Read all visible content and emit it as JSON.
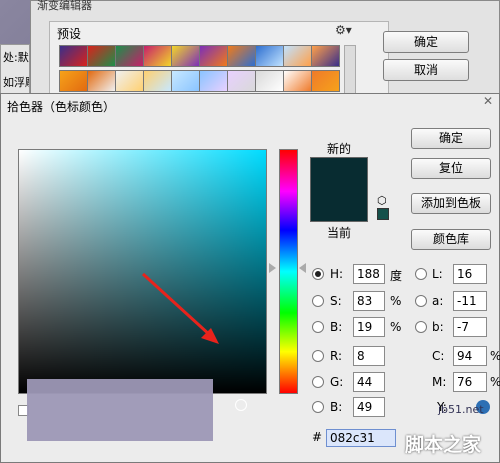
{
  "bg_dialog": {
    "title": "渐变编辑器",
    "presets_label": "预设",
    "gear_glyph": "⚙▾",
    "ok": "确定",
    "cancel": "取消",
    "left_lines": [
      "处:默认",
      "如浮雕"
    ]
  },
  "preset_swatches": [
    [
      "#3a2f8a",
      "#d9221c",
      "#1c8f4a",
      "#c71f6a",
      "#f2d62a",
      "#7c2fb8",
      "#f07a1a",
      "#2e6fd0",
      "#c0e2ff",
      "#ffa04a"
    ],
    [
      "#f6a21a",
      "#e26a10",
      "#f0f0f0",
      "#ffd070",
      "#c7e8ff",
      "#8ac4ff",
      "#e8d0ff",
      "#d9d9d9",
      "#ffffff",
      "#ef7a2a"
    ]
  ],
  "picker": {
    "title": "拾色器（色标颜色）",
    "close_glyph": "✕",
    "new_label": "新的",
    "current_label": "当前",
    "new_color": "#082c31",
    "current_color": "#082c31",
    "cube_icon": "⬡",
    "buttons": {
      "ok": "确定",
      "reset": "复位",
      "add_to_swatches": "添加到色板",
      "color_libraries": "颜色库"
    },
    "hsb": {
      "h": "188",
      "s": "83",
      "b": "19",
      "h_unit": "度",
      "s_unit": "%",
      "b_unit": "%"
    },
    "rgb": {
      "r": "8",
      "g": "44",
      "b": "49"
    },
    "lab": {
      "l": "16",
      "a": "-11",
      "b": "-7"
    },
    "cmyk": {
      "c": "94",
      "m": "76",
      "c_unit": "%",
      "m_unit": "%",
      "y_label": "Y:"
    },
    "labels": {
      "h": "H:",
      "s": "S:",
      "b": "B:",
      "r": "R:",
      "g": "G:",
      "b2": "B:",
      "l": "L:",
      "a": "a:",
      "lb": "b:",
      "c": "C:",
      "m": "M:",
      "hash": "#"
    },
    "hex": "082c31"
  },
  "watermark": {
    "site": "jb51.net",
    "name": "脚本之家"
  }
}
